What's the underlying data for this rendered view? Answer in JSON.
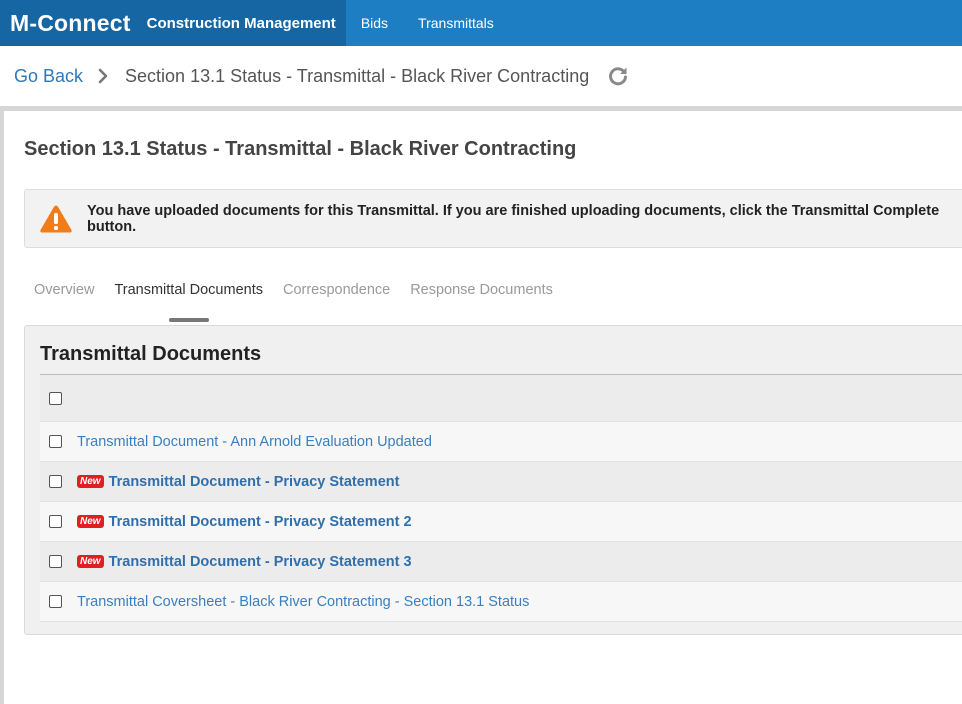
{
  "nav": {
    "brand": "M-Connect",
    "items": [
      {
        "label": "Construction Management",
        "active": true
      },
      {
        "label": "Bids",
        "active": false
      },
      {
        "label": "Transmittals",
        "active": false
      }
    ]
  },
  "breadcrumb": {
    "back_label": "Go Back",
    "current": "Section 13.1 Status - Transmittal - Black River Contracting"
  },
  "page_title": "Section 13.1 Status - Transmittal - Black River Contracting",
  "alert": {
    "icon": "warning-icon",
    "color": "#f07d19",
    "message": "You have uploaded documents for this Transmittal. If you are finished uploading documents, click the Transmittal Complete button."
  },
  "tabs": [
    {
      "label": "Overview",
      "active": false
    },
    {
      "label": "Transmittal Documents",
      "active": true
    },
    {
      "label": "Correspondence",
      "active": false
    },
    {
      "label": "Response Documents",
      "active": false
    }
  ],
  "documents_panel": {
    "title": "Transmittal Documents",
    "new_badge_label": "New",
    "rows": [
      {
        "name": "Transmittal Document - Ann Arnold Evaluation Updated",
        "is_new": false
      },
      {
        "name": "Transmittal Document - Privacy Statement",
        "is_new": true
      },
      {
        "name": "Transmittal Document - Privacy Statement 2",
        "is_new": true
      },
      {
        "name": "Transmittal Document - Privacy Statement 3",
        "is_new": true
      },
      {
        "name": "Transmittal Coversheet - Black River Contracting - Section 13.1 Status",
        "is_new": false
      }
    ]
  },
  "colors": {
    "nav_bg": "#1d7ec4",
    "nav_active_bg": "#1566a3",
    "link": "#3a7fbf",
    "badge": "#e02020"
  }
}
